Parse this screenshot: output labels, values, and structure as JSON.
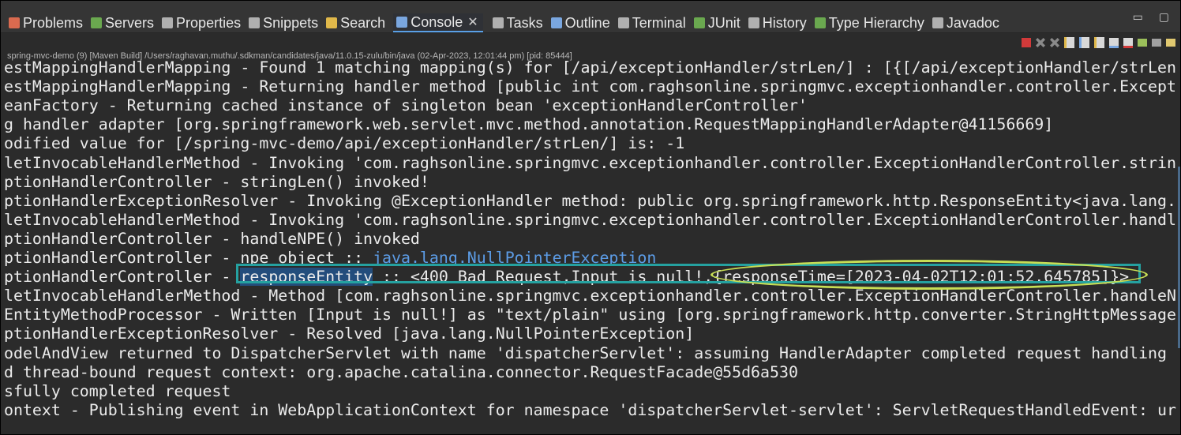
{
  "tabs": [
    {
      "label": "Problems",
      "icon": "problems-icon",
      "color": "#d96a4f"
    },
    {
      "label": "Servers",
      "icon": "servers-icon",
      "color": "#6aa84f"
    },
    {
      "label": "Properties",
      "icon": "properties-icon",
      "color": "#b0b0b0"
    },
    {
      "label": "Snippets",
      "icon": "snippets-icon",
      "color": "#b0b0b0"
    },
    {
      "label": "Search",
      "icon": "search-icon",
      "color": "#e0b84a"
    },
    {
      "label": "Console",
      "icon": "console-icon",
      "color": "#7aa7e0",
      "active": true
    },
    {
      "label": "Tasks",
      "icon": "tasks-icon",
      "color": "#b0b0b0"
    },
    {
      "label": "Outline",
      "icon": "outline-icon",
      "color": "#7aa7e0"
    },
    {
      "label": "Terminal",
      "icon": "terminal-icon",
      "color": "#b0b0b0"
    },
    {
      "label": "JUnit",
      "icon": "junit-icon",
      "color": "#6aa84f"
    },
    {
      "label": "History",
      "icon": "history-icon",
      "color": "#b0b0b0"
    },
    {
      "label": "Type Hierarchy",
      "icon": "type-hierarchy-icon",
      "color": "#6aa84f"
    },
    {
      "label": "Javadoc",
      "icon": "javadoc-icon",
      "color": "#b0b0b0"
    }
  ],
  "console_close": "✕",
  "window_controls": "▭ ▢",
  "process_path": "spring-mvc-demo (9) [Maven Build] /Users/raghavan.muthu/.sdkman/candidates/java/11.0.15-zulu/bin/java  (02-Apr-2023, 12:01:44 pm) [pid: 85444]",
  "log_lines": [
    "estMappingHandlerMapping - Found 1 matching mapping(s) for [/api/exceptionHandler/strLen/] : [{[/api/exceptionHandler/strLen",
    "estMappingHandlerMapping - Returning handler method [public int com.raghsonline.springmvc.exceptionhandler.controller.Except",
    "eanFactory - Returning cached instance of singleton bean 'exceptionHandlerController'",
    "g handler adapter [org.springframework.web.servlet.mvc.method.annotation.RequestMappingHandlerAdapter@41156669]",
    "odified value for [/spring-mvc-demo/api/exceptionHandler/strLen/] is: -1",
    "letInvocableHandlerMethod - Invoking 'com.raghsonline.springmvc.exceptionhandler.controller.ExceptionHandlerController.strin",
    "ptionHandlerController - stringLen() invoked!",
    "ptionHandlerExceptionResolver - Invoking @ExceptionHandler method: public org.springframework.http.ResponseEntity<java.lang.",
    "letInvocableHandlerMethod - Invoking 'com.raghsonline.springmvc.exceptionhandler.controller.ExceptionHandlerController.handl",
    "ptionHandlerController - handleNPE() invoked"
  ],
  "npe_line": {
    "prefix": "ptionHandlerController - npe object :: ",
    "link": "java.lang.NullPointerException"
  },
  "response_line": {
    "prefix": "ptionHandlerController - ",
    "selected": "responseEntity",
    "rest": " :: <400 Bad Request,Input is null!,{responseTime=[2023-04-02T12:01:52.645785]}>"
  },
  "log_lines_after": [
    "letInvocableHandlerMethod - Method [com.raghsonline.springmvc.exceptionhandler.controller.ExceptionHandlerController.handleN",
    "EntityMethodProcessor - Written [Input is null!] as \"text/plain\" using [org.springframework.http.converter.StringHttpMessage",
    "ptionHandlerExceptionResolver - Resolved [java.lang.NullPointerException]",
    "odelAndView returned to DispatcherServlet with name 'dispatcherServlet': assuming HandlerAdapter completed request handling",
    "d thread-bound request context: org.apache.catalina.connector.RequestFacade@55d6a530",
    "sfully completed request",
    "ontext - Publishing event in WebApplicationContext for namespace 'dispatcherServlet-servlet': ServletRequestHandledEvent: ur"
  ],
  "colors": {
    "background": "#2b2b2b",
    "text": "#ebebeb",
    "link": "#5c9ce6",
    "highlight_rect": "#25a1a0",
    "highlight_oval": "#c8de55",
    "selection": "#234d7c"
  }
}
